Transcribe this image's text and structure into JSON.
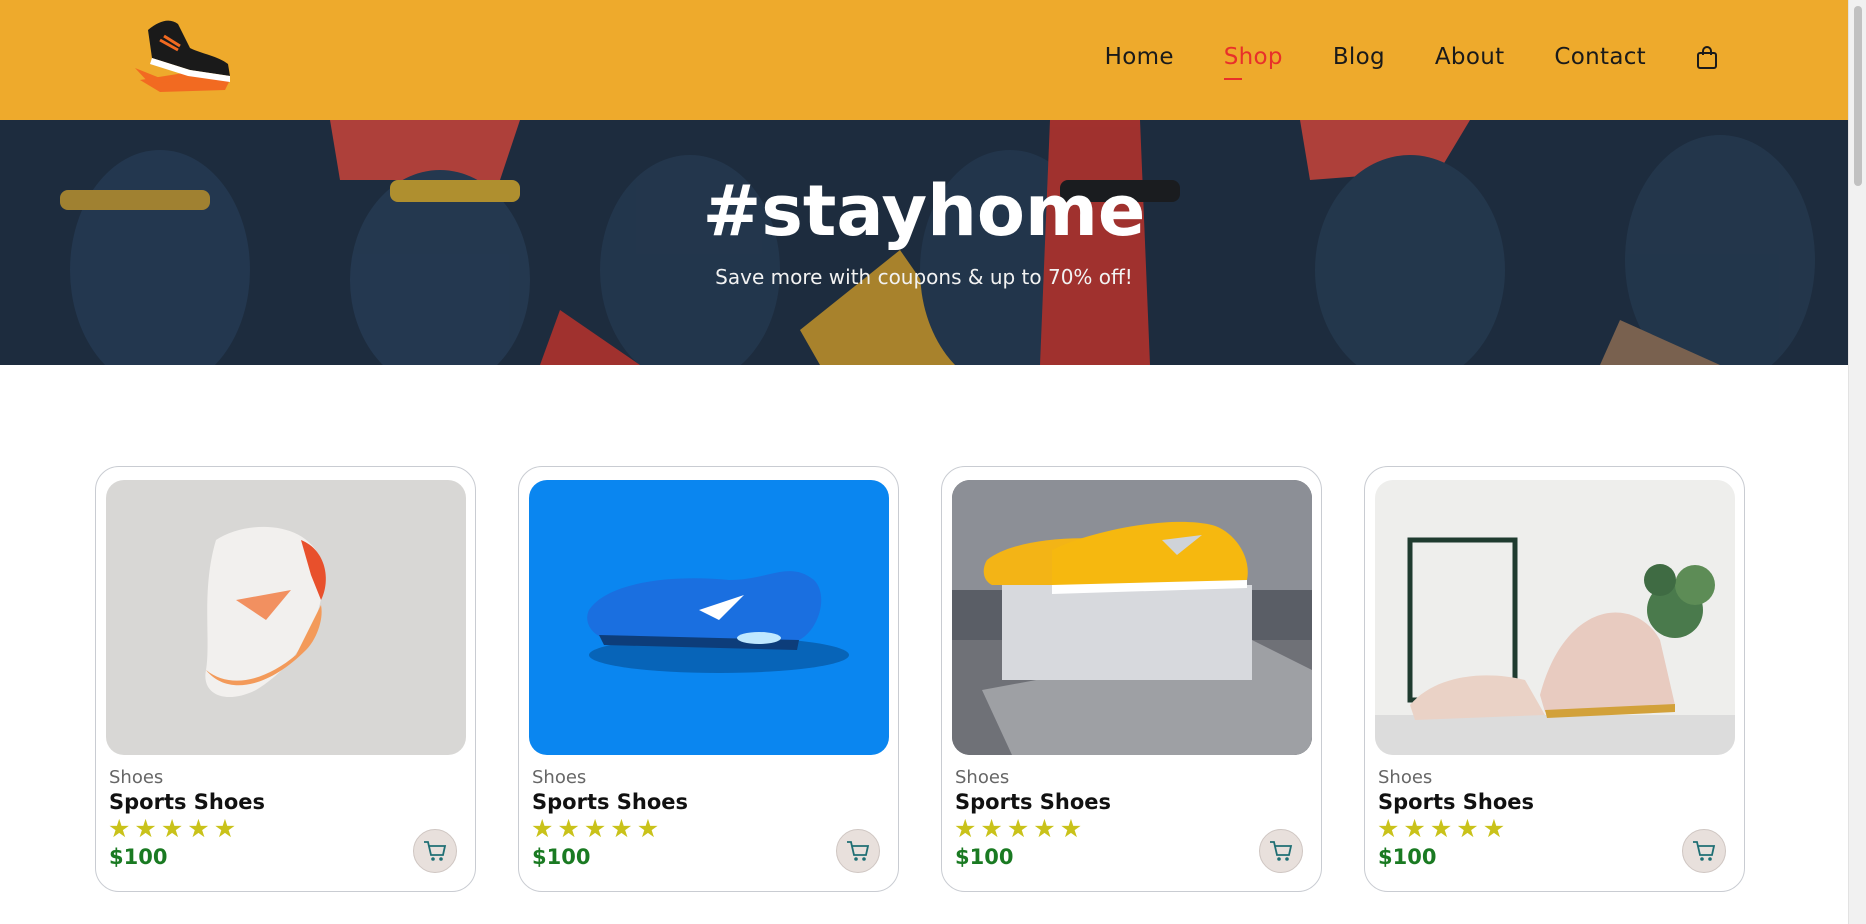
{
  "header": {
    "nav": [
      {
        "label": "Home"
      },
      {
        "label": "Shop"
      },
      {
        "label": "Blog"
      },
      {
        "label": "About"
      },
      {
        "label": "Contact"
      }
    ],
    "active_nav": "Shop",
    "logo_icon": "sneaker-logo-icon",
    "cart_icon": "shopping-bag-icon",
    "bg_color": "#eeaa2c",
    "active_color": "#e8302a"
  },
  "hero": {
    "title": "#stayhome",
    "subtitle": "Save more with coupons & up to 70% off!"
  },
  "products": [
    {
      "brand": "Shoes",
      "name": "Sports Shoes",
      "rating": 5,
      "price": "$100",
      "image": "white-orange-sneaker-image",
      "cart_icon": "cart-icon"
    },
    {
      "brand": "Shoes",
      "name": "Sports Shoes",
      "rating": 5,
      "price": "$100",
      "image": "blue-sneaker-image",
      "cart_icon": "cart-icon"
    },
    {
      "brand": "Shoes",
      "name": "Sports Shoes",
      "rating": 5,
      "price": "$100",
      "image": "yellow-sneakers-on-box-image",
      "cart_icon": "cart-icon"
    },
    {
      "brand": "Shoes",
      "name": "Sports Shoes",
      "rating": 5,
      "price": "$100",
      "image": "pink-brogue-shoes-image",
      "cart_icon": "cart-icon"
    }
  ],
  "colors": {
    "price": "#1a7a22",
    "star": "#c9c21a"
  }
}
